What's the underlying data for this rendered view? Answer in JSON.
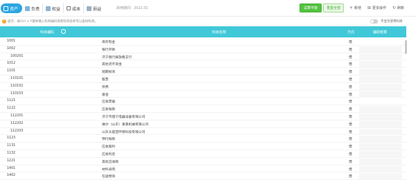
{
  "tabs": [
    {
      "label": "资产",
      "icon": "assets-icon",
      "active": true
    },
    {
      "label": "负债",
      "icon": "liabilities-icon",
      "active": false
    },
    {
      "label": "权益",
      "icon": "equity-icon",
      "active": false
    },
    {
      "label": "成本",
      "icon": "cost-icon",
      "active": false
    },
    {
      "label": "损益",
      "icon": "profit-loss-icon",
      "active": false
    }
  ],
  "period": "启用期间：2022.01",
  "toolbar": {
    "trial_balance": "试算平衡",
    "rebuild": "重置全部",
    "add": "新增",
    "more": "更多操作",
    "refresh": "刷新"
  },
  "notice": {
    "text": "提示：按Ctrl + F键并输入科目编码或者科目名称可以查找科目。",
    "toggle_label": "不显示禁用科目"
  },
  "table": {
    "headers": {
      "code": "科目编码",
      "name": "科目名称",
      "direction": "方向",
      "auxiliary": "辅助核算"
    },
    "rows": [
      {
        "code": "1001",
        "name": "库存现金",
        "direction": "借",
        "level": 1,
        "aux": false
      },
      {
        "code": "1002",
        "name": "银行存款",
        "direction": "借",
        "level": 1,
        "aux": true
      },
      {
        "code": "100201",
        "name": "济宁银行解放路支行",
        "direction": "借",
        "level": 2,
        "aux": true
      },
      {
        "code": "1012",
        "name": "其他货币资金",
        "direction": "借",
        "level": 1,
        "aux": true
      },
      {
        "code": "1101",
        "name": "短期投资",
        "direction": "借",
        "level": 1,
        "aux": true
      },
      {
        "code": "110101",
        "name": "股票",
        "direction": "借",
        "level": 2,
        "aux": true
      },
      {
        "code": "110102",
        "name": "债券",
        "direction": "借",
        "level": 2,
        "aux": true
      },
      {
        "code": "110103",
        "name": "基金",
        "direction": "借",
        "level": 2,
        "aux": true
      },
      {
        "code": "1121",
        "name": "应收票据",
        "direction": "借",
        "level": 1,
        "aux": false
      },
      {
        "code": "1122",
        "name": "应收账款",
        "direction": "借",
        "level": 1,
        "aux": true
      },
      {
        "code": "112201",
        "name": "济宁市建宁电器设备有限公司",
        "direction": "借",
        "level": 2,
        "aux": true
      },
      {
        "code": "112202",
        "name": "维尔（山东）重质机械有限公司",
        "direction": "借",
        "level": 2,
        "aux": true
      },
      {
        "code": "112203",
        "name": "山东天晨塑环保科技有限公司",
        "direction": "借",
        "level": 2,
        "aux": true
      },
      {
        "code": "1123",
        "name": "预付账款",
        "direction": "借",
        "level": 1,
        "aux": true
      },
      {
        "code": "1131",
        "name": "应收股利",
        "direction": "借",
        "level": 1,
        "aux": true
      },
      {
        "code": "1132",
        "name": "应收利息",
        "direction": "借",
        "level": 1,
        "aux": true
      },
      {
        "code": "1221",
        "name": "其他应收款",
        "direction": "借",
        "level": 1,
        "aux": true
      },
      {
        "code": "1401",
        "name": "材料采购",
        "direction": "借",
        "level": 1,
        "aux": true
      },
      {
        "code": "1402",
        "name": "在途物资",
        "direction": "借",
        "level": 1,
        "aux": true
      }
    ]
  },
  "colors": {
    "header_bg": "#40c8d8",
    "active_tab": "#2aa6e1",
    "green_button": "#52c240",
    "warning": "#f5a623"
  }
}
